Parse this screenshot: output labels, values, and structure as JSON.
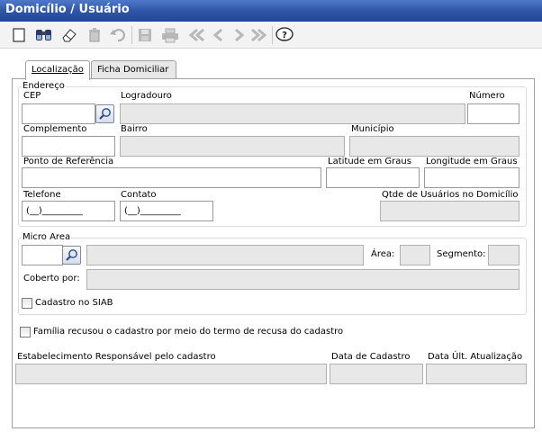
{
  "window": {
    "title": "Domicílio / Usuário"
  },
  "toolbar": {
    "buttons": [
      "new-icon",
      "search-icon",
      "clear-icon",
      "delete-icon",
      "undo-icon",
      "save-icon",
      "print-icon",
      "first-icon",
      "prev-icon",
      "next-icon",
      "last-icon",
      "help-icon"
    ]
  },
  "tabs": [
    {
      "label": "Localização",
      "active": true
    },
    {
      "label": "Ficha Domiciliar",
      "active": false
    }
  ],
  "endereco": {
    "legend": "Endereço",
    "cep_label": "CEP",
    "logradouro_label": "Logradouro",
    "numero_label": "Número",
    "complemento_label": "Complemento",
    "bairro_label": "Bairro",
    "municipio_label": "Município",
    "ponto_label": "Ponto de Referência",
    "latitude_label": "Latitude em Graus",
    "longitude_label": "Longitude em Graus",
    "telefone_label": "Telefone",
    "telefone_value": "(__)_________",
    "contato_label": "Contato",
    "contato_value": "(__)_________",
    "qtde_label": "Qtde de Usuários no Domicílio"
  },
  "micro_area": {
    "legend": "Micro Area",
    "area_label": "Área:",
    "segmento_label": "Segmento:",
    "coberto_label": "Coberto por:",
    "cadastro_siab_label": "Cadastro no SIAB"
  },
  "familia_recusou_label": "Família recusou o cadastro por meio do termo de recusa do cadastro",
  "bottom": {
    "estabelecimento_label": "Estabelecimento Responsável pelo cadastro",
    "data_cadastro_label": "Data de Cadastro",
    "data_atualizacao_label": "Data Últ. Atualização"
  },
  "colors": {
    "titlebar": "#2f56a8",
    "readonly_field": "#e8e8e8"
  }
}
